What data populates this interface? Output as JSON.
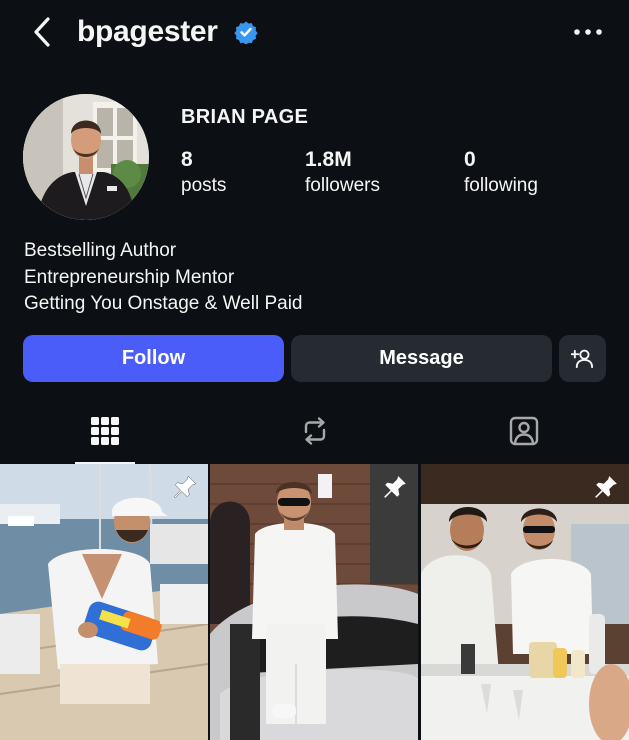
{
  "header": {
    "username": "bpagester",
    "verified": true,
    "back_icon": "chevron-left-icon",
    "more_icon": "more-horizontal-icon"
  },
  "profile": {
    "display_name": "BRIAN PAGE",
    "stats": {
      "posts": {
        "value": "8",
        "label": "posts"
      },
      "followers": {
        "value": "1.8M",
        "label": "followers"
      },
      "following": {
        "value": "0",
        "label": "following"
      }
    },
    "bio": [
      "Bestselling Author",
      "Entrepreneurship Mentor",
      "Getting You Onstage & Well Paid"
    ]
  },
  "actions": {
    "follow_label": "Follow",
    "message_label": "Message",
    "suggest_icon": "add-person-icon"
  },
  "tabs": [
    {
      "name": "posts",
      "icon": "grid-icon",
      "active": true
    },
    {
      "name": "reels",
      "icon": "repost-icon",
      "active": false
    },
    {
      "name": "tagged",
      "icon": "tagged-user-icon",
      "active": false
    }
  ],
  "posts": [
    {
      "pinned": true,
      "scene": "man in white cap on boat dock holding water gun"
    },
    {
      "pinned": true,
      "scene": "man in white outfit stepping out of sports car"
    },
    {
      "pinned": true,
      "scene": "two men making drinks on a yacht"
    }
  ],
  "colors": {
    "background": "#0c1014",
    "follow_button": "#4a5df9",
    "secondary_button": "#262a31",
    "verified_badge": "#3897f0"
  }
}
